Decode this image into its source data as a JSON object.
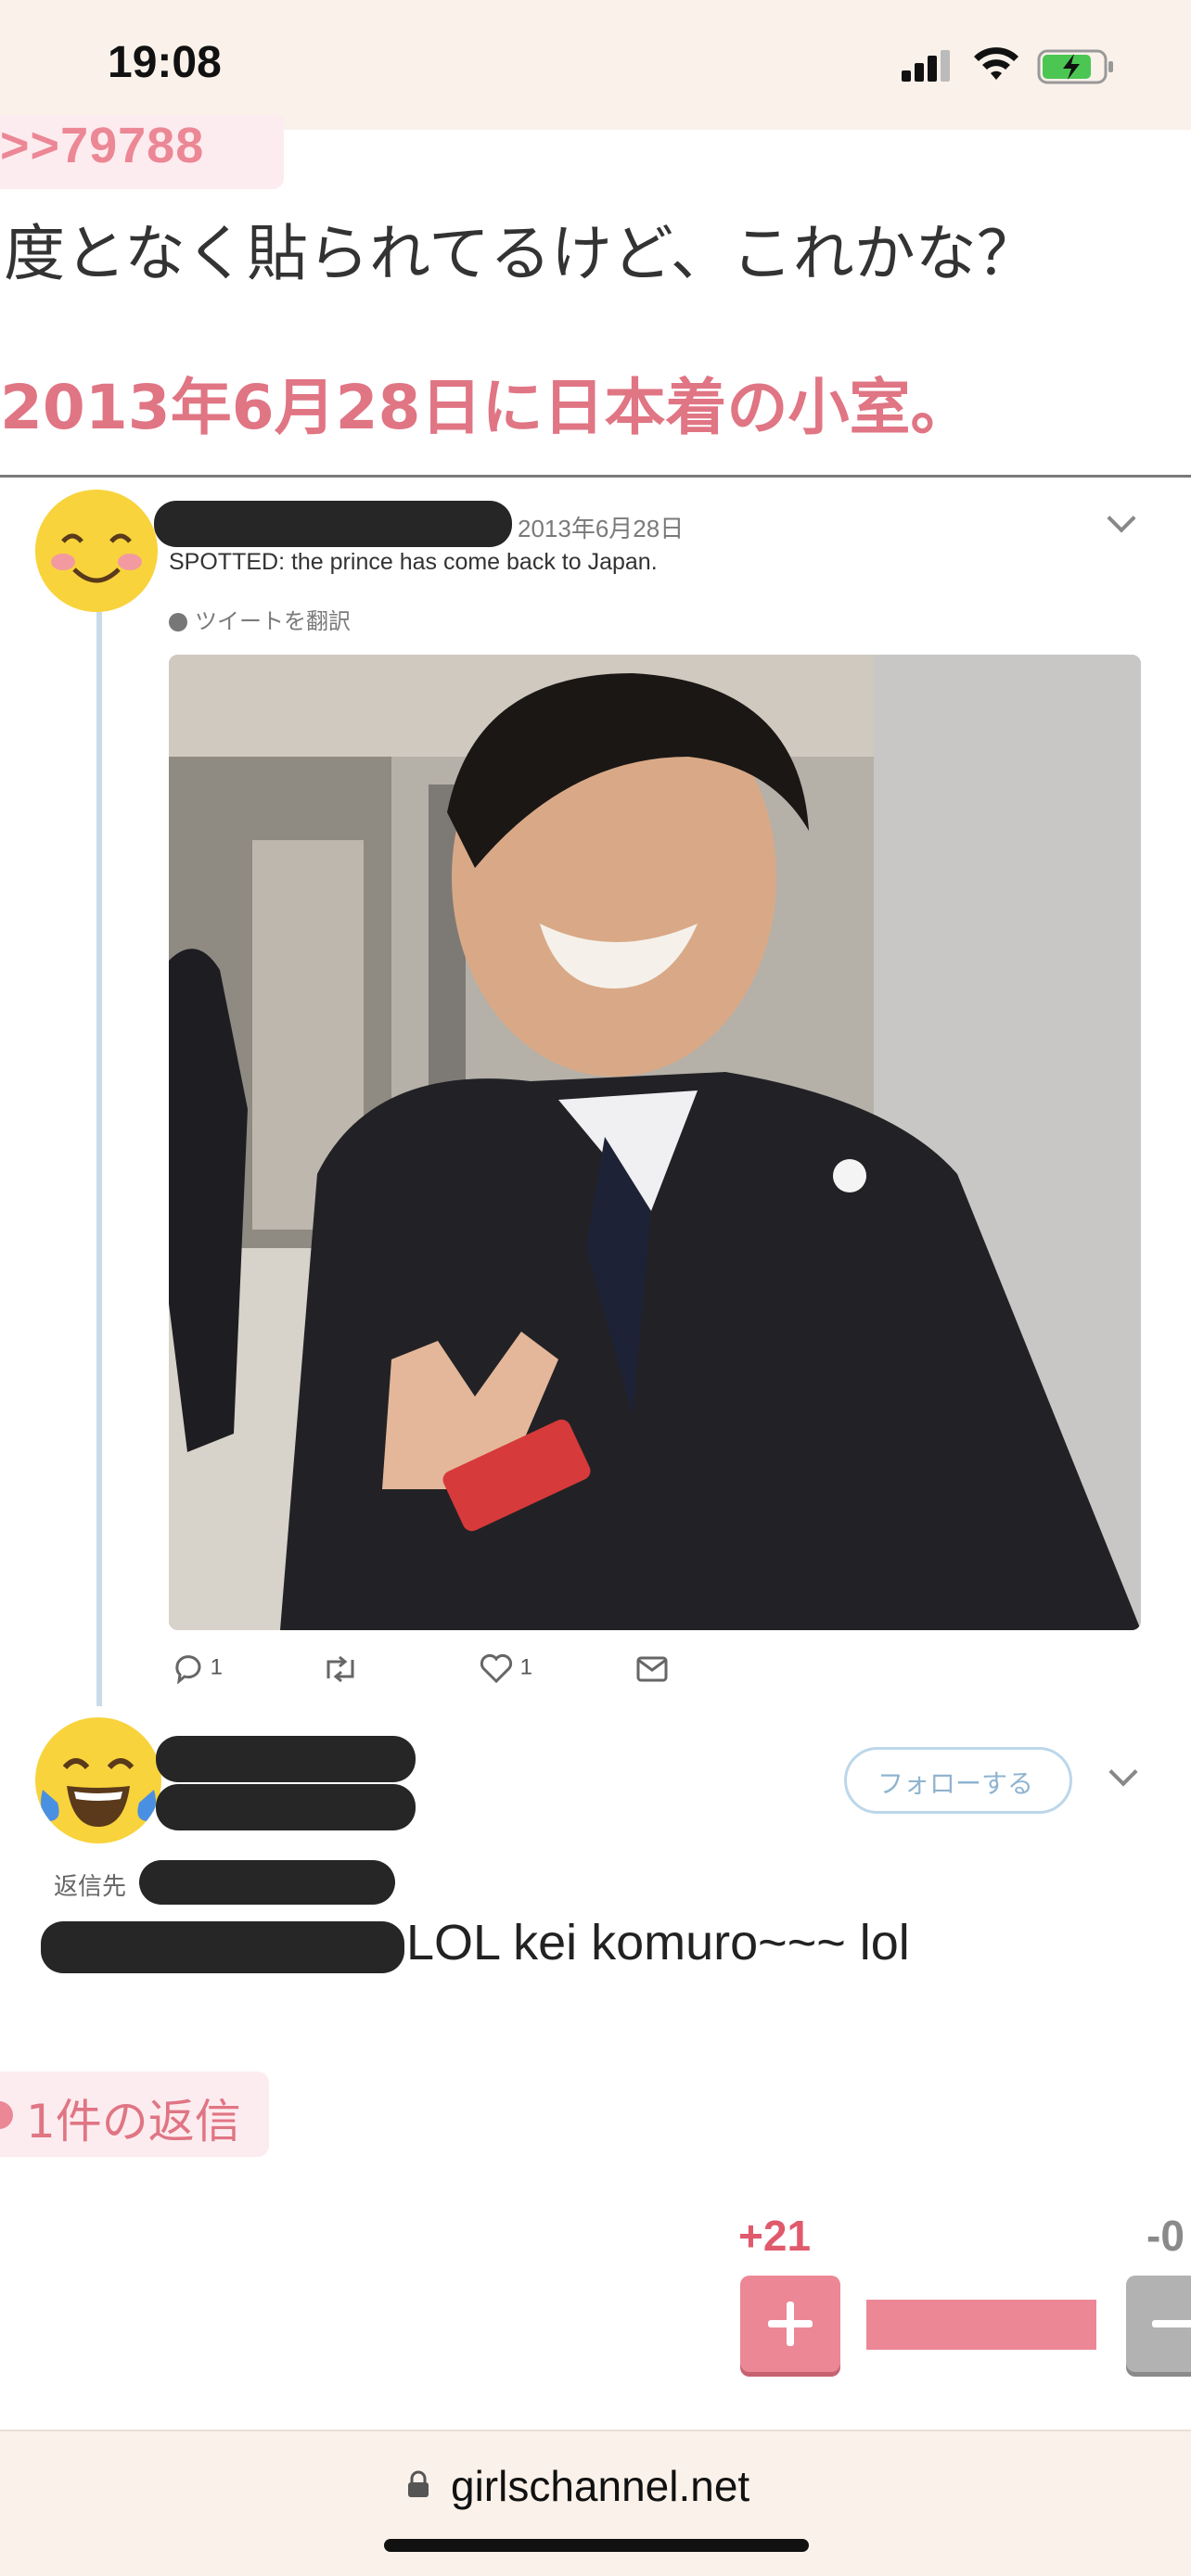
{
  "status_bar": {
    "time": "19:08",
    "icons": [
      "cellular-signal-icon",
      "wifi-icon",
      "battery-charging-icon"
    ]
  },
  "post": {
    "anchor": ">>79788",
    "comment_line1": "度となく貼られてるけど、これかな？",
    "comment_line2": "2013年6月28日に日本着の小室。"
  },
  "tweet": {
    "date": "2013年6月28日",
    "text": "SPOTTED: the prince has come back to Japan.",
    "translate": "ツイートを翻訳",
    "reply_count": "1",
    "like_count": "1",
    "emoji_1": "smiling-face-emoji",
    "emoji_2": "tears-of-joy-emoji"
  },
  "reply": {
    "follow": "フォローする",
    "reply_to": "返信先",
    "text": "LOL kei komuro~~~ lol"
  },
  "replies_badge": "1件の返信",
  "votes": {
    "plus": "+21",
    "minus": "-0"
  },
  "browser": {
    "url": "girlschannel.net"
  },
  "colors": {
    "accent_pink": "#ec8795",
    "text_pink": "#e07584",
    "background_top": "#faf1ea"
  }
}
